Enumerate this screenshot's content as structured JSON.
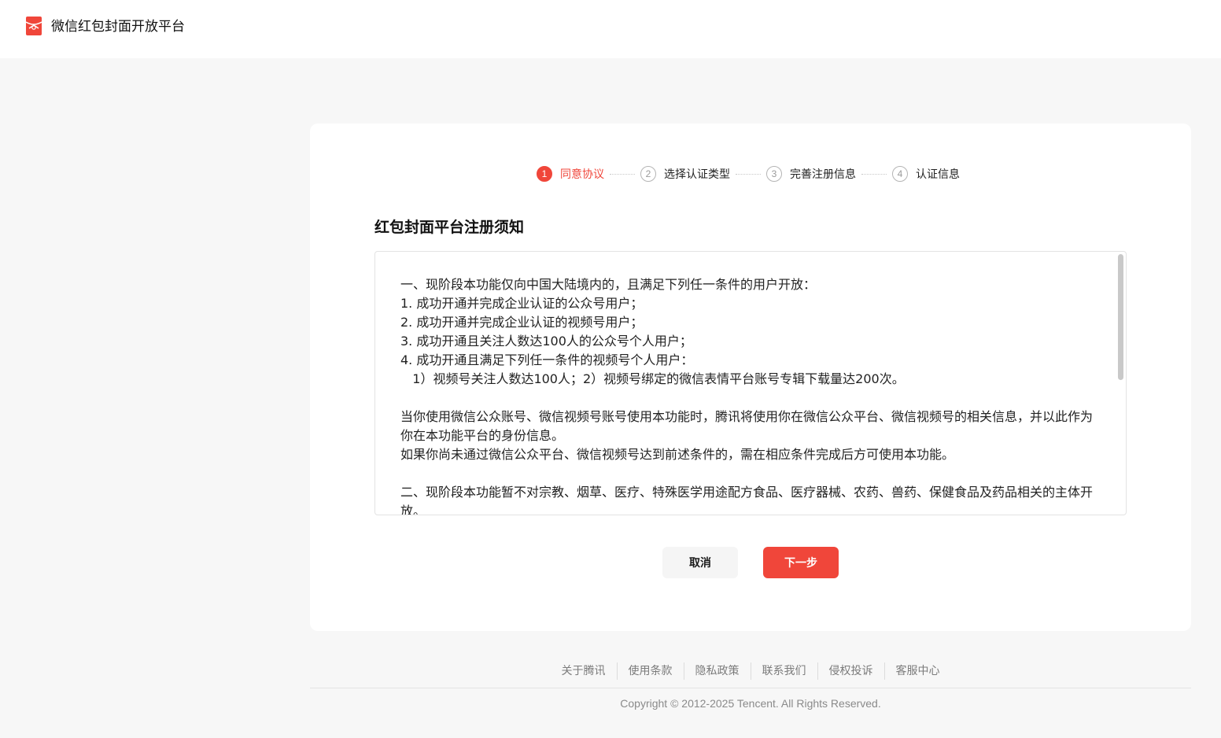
{
  "header": {
    "brand": "微信红包封面开放平台",
    "logo_icon": "red-envelope-icon",
    "accent_color": "#f0463a"
  },
  "steps": [
    {
      "num": "1",
      "label": "同意协议",
      "active": true
    },
    {
      "num": "2",
      "label": "选择认证类型",
      "active": false
    },
    {
      "num": "3",
      "label": "完善注册信息",
      "active": false
    },
    {
      "num": "4",
      "label": "认证信息",
      "active": false
    }
  ],
  "agreement": {
    "title": "红包封面平台注册须知",
    "lines": [
      "一、现阶段本功能仅向中国大陆境内的，且满足下列任一条件的用户开放：",
      "1. 成功开通并完成企业认证的公众号用户；",
      "2. 成功开通并完成企业认证的视频号用户；",
      "3. 成功开通且关注人数达100人的公众号个人用户；",
      "4. 成功开通且满足下列任一条件的视频号个人用户：",
      "   1）视频号关注人数达100人；2）视频号绑定的微信表情平台账号专辑下载量达200次。",
      "",
      "当你使用微信公众账号、微信视频号账号使用本功能时，腾讯将使用你在微信公众平台、微信视频号的相关信息，并以此作为你在本功能平台的身份信息。",
      "如果你尚未通过微信公众平台、微信视频号达到前述条件的，需在相应条件完成后方可使用本功能。",
      "",
      "二、现阶段本功能暂不对宗教、烟草、医疗、特殊医学用途配方食品、医疗器械、农药、兽药、保健食品及药品相关的主体开放。"
    ]
  },
  "actions": {
    "cancel_label": "取消",
    "next_label": "下一步"
  },
  "footer": {
    "links": [
      "关于腾讯",
      "使用条款",
      "隐私政策",
      "联系我们",
      "侵权投诉",
      "客服中心"
    ],
    "copyright": "Copyright © 2012-2025 Tencent. All Rights Reserved."
  }
}
